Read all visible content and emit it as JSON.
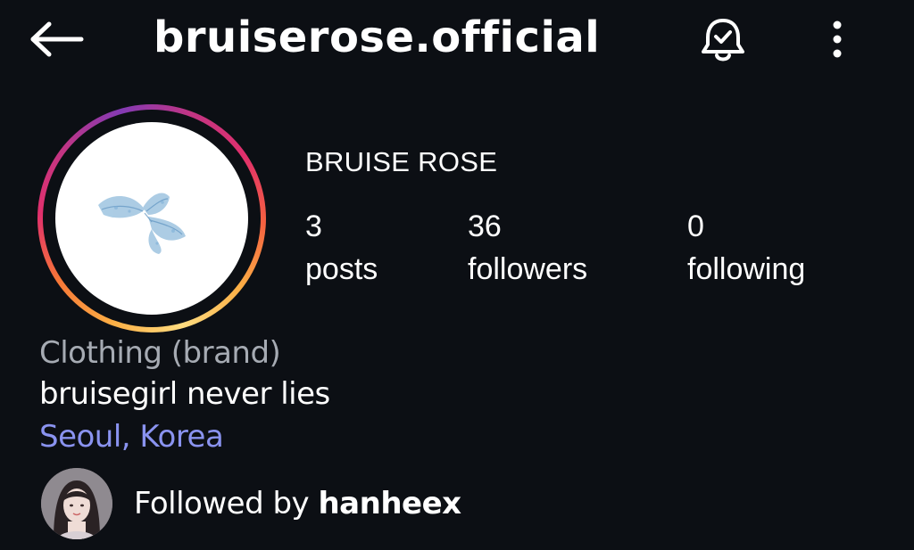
{
  "header": {
    "username": "bruiserose.official",
    "back_icon": "arrow-left-icon",
    "bell_icon": "bell-check-icon",
    "more_icon": "vertical-dots-icon"
  },
  "profile": {
    "display_name": "BRUISE ROSE",
    "avatar_icon": "butterfly-logo",
    "stats": {
      "posts": {
        "count": "3",
        "label": "posts"
      },
      "followers": {
        "count": "36",
        "label": "followers"
      },
      "following": {
        "count": "0",
        "label": "following"
      }
    },
    "category": "Clothing (brand)",
    "bio": "bruisegirl never lies",
    "location": "Seoul, Korea"
  },
  "followed_by": {
    "prefix": "Followed by ",
    "handle": "hanheex"
  },
  "colors": {
    "background": "#0c0f14",
    "text": "#ffffff",
    "muted": "#a6abb3",
    "link": "#8a93f0",
    "ring_gradient": [
      "#fcaf45",
      "#e1306c",
      "#c13584",
      "#833ab4"
    ]
  }
}
